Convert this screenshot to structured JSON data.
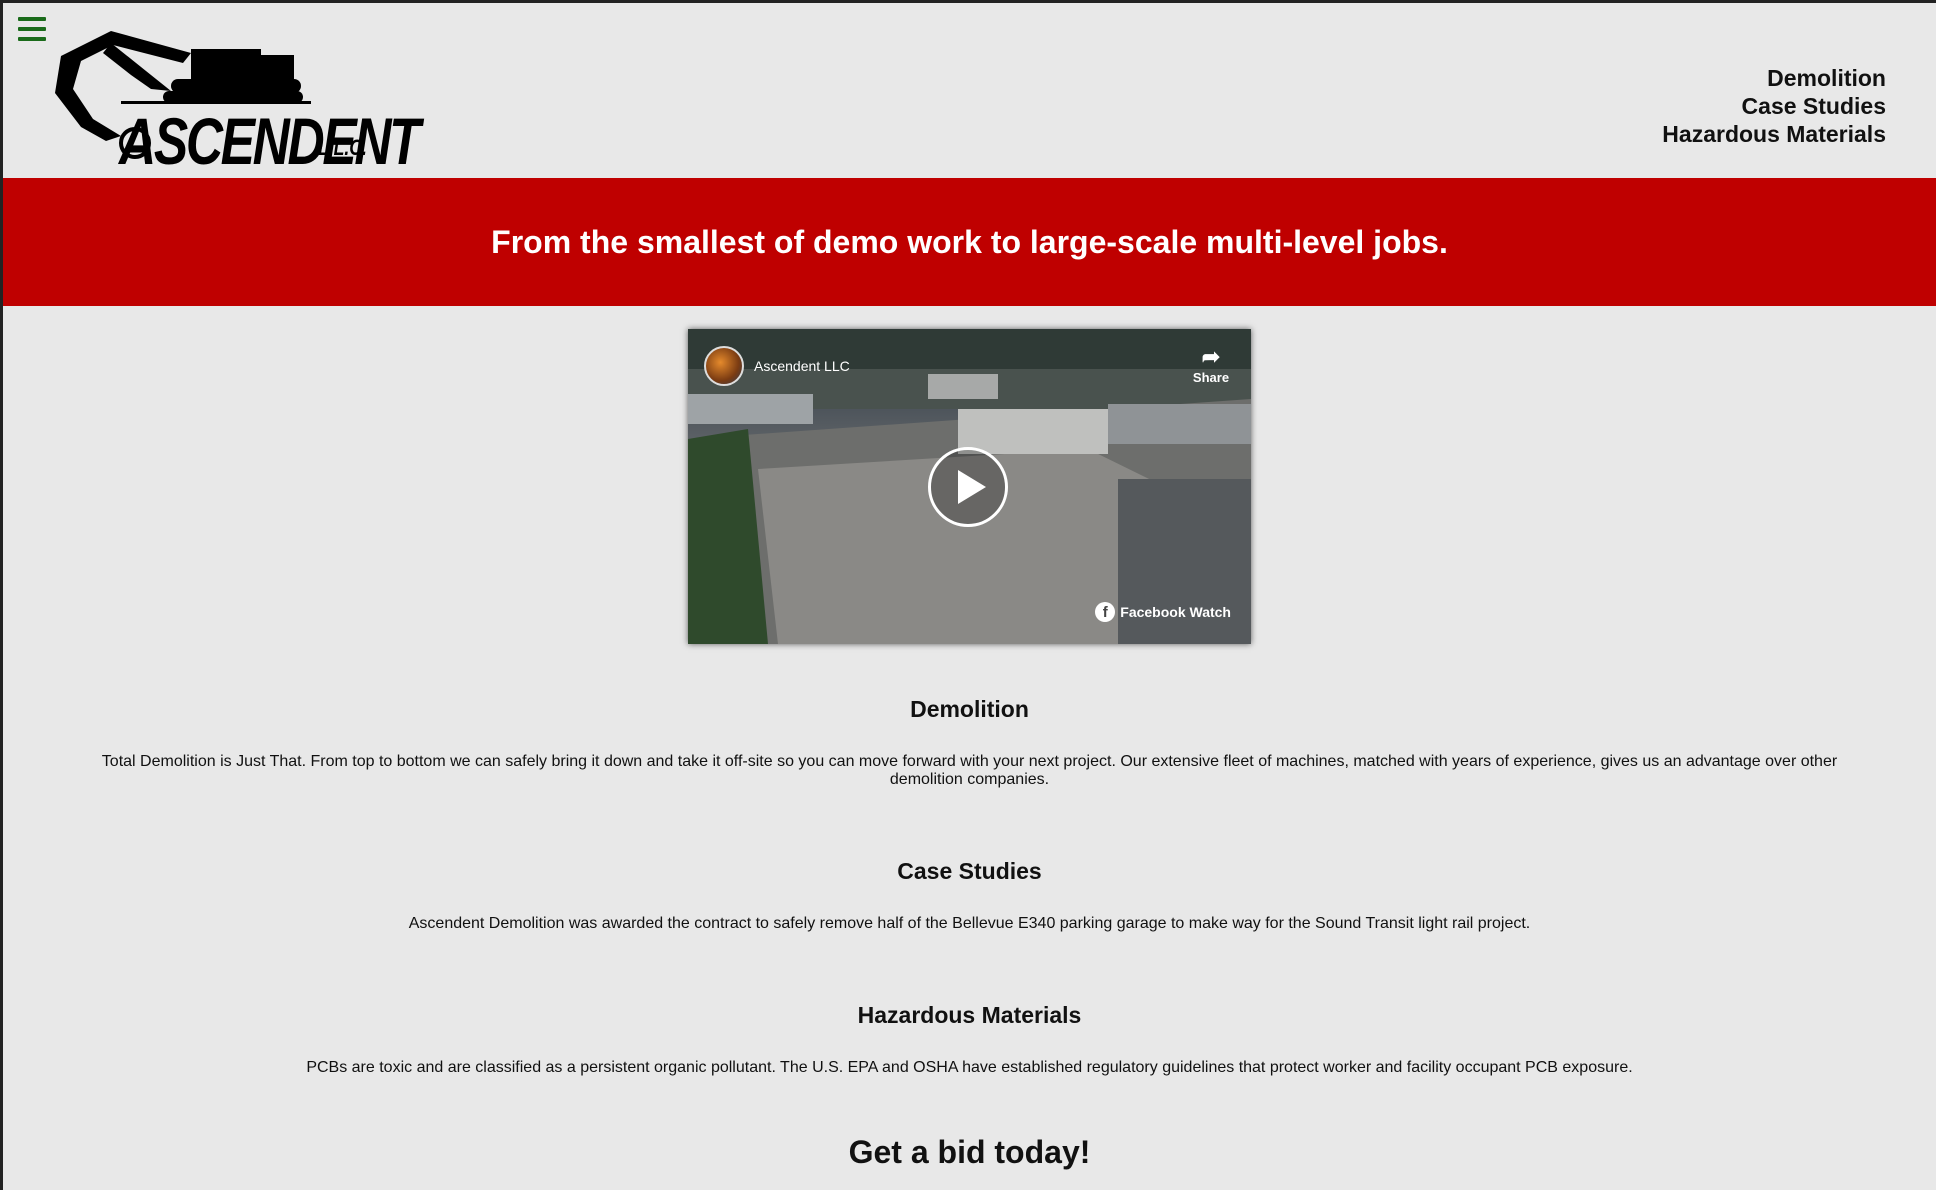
{
  "header": {
    "menu_icon": "hamburger-menu-icon",
    "logo": {
      "name": "ASCENDENT",
      "suffix": "L.L.C."
    },
    "nav": [
      {
        "label": "Demolition"
      },
      {
        "label": "Case Studies"
      },
      {
        "label": "Hazardous Materials"
      }
    ]
  },
  "banner": {
    "text": "From the smallest of demo work to large-scale multi-level jobs.",
    "color": "#bf0000"
  },
  "video": {
    "channel": "Ascendent LLC",
    "share_label": "Share",
    "platform_label": "Facebook Watch",
    "icons": [
      "share-icon",
      "play-icon",
      "facebook-icon"
    ]
  },
  "sections": [
    {
      "title": "Demolition",
      "body": "Total Demolition is Just That. From top to bottom we can safely bring it down and take it off-site so you can move forward with your next project. Our extensive fleet of machines, matched with years of experience, gives us an advantage over other demolition companies."
    },
    {
      "title": "Case Studies",
      "body": "Ascendent Demolition was awarded the contract to safely remove half of the Bellevue E340 parking garage to make way for the Sound Transit light rail project."
    },
    {
      "title": "Hazardous Materials",
      "body": "PCBs are toxic and are classified as a persistent organic pollutant. The U.S. EPA and OSHA have established regulatory guidelines that protect worker and facility occupant PCB exposure."
    }
  ],
  "cta": {
    "text": "Get a bid today!"
  }
}
